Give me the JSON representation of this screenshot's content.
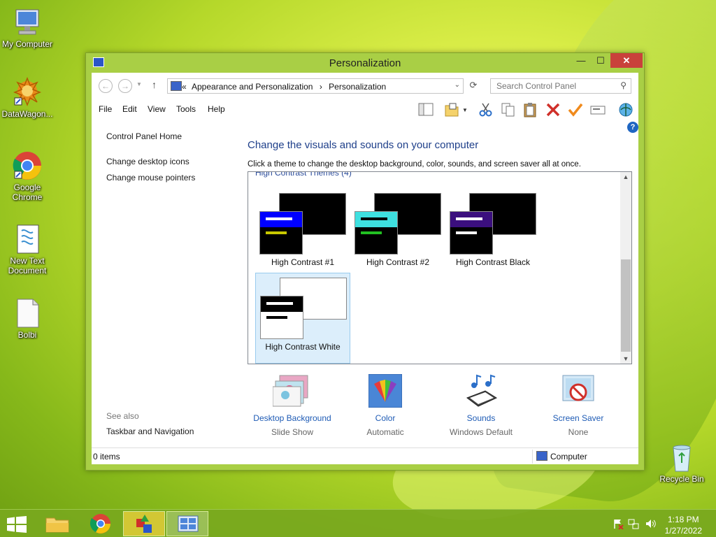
{
  "desktop": {
    "icons": [
      {
        "label": "My Computer",
        "icon": "monitor-icon"
      },
      {
        "label": "DataWagon...",
        "icon": "datawagon-icon"
      },
      {
        "label": "Google Chrome",
        "icon": "chrome-icon"
      },
      {
        "label": "New Text Document",
        "icon": "text-document-icon"
      },
      {
        "label": "Bolbi",
        "icon": "blank-file-icon"
      },
      {
        "label": "Recycle Bin",
        "icon": "recycle-bin-icon"
      }
    ]
  },
  "window": {
    "title": "Personalization",
    "controls": {
      "minimize": "—",
      "maximize": "☐",
      "close": "✕"
    },
    "address": {
      "prefix": "«",
      "crumb1": "Appearance and Personalization",
      "sep": "›",
      "crumb2": "Personalization"
    },
    "search": {
      "placeholder": "Search Control Panel"
    },
    "menu": [
      "File",
      "Edit",
      "View",
      "Tools",
      "Help"
    ],
    "left_pane": {
      "home": "Control Panel Home",
      "links": [
        "Change desktop icons",
        "Change mouse pointers"
      ],
      "see_also_header": "See also",
      "see_also": [
        "Taskbar and Navigation"
      ]
    },
    "main": {
      "heading": "Change the visuals and sounds on your computer",
      "subtext": "Click a theme to change the desktop background, color, sounds, and screen saver all at once.",
      "group_header": "High Contrast Themes (4)",
      "themes": [
        {
          "name": "High Contrast #1",
          "accent": "#0000ff",
          "bar2": "#c8c800"
        },
        {
          "name": "High Contrast #2",
          "accent": "#3ee0e0",
          "bar2": "#22c022"
        },
        {
          "name": "High Contrast Black",
          "accent": "#3b0f7e",
          "bar2": "#ffffff"
        },
        {
          "name": "High Contrast White",
          "accent": "#000000",
          "bar2": "#000000"
        }
      ],
      "selected_theme": "High Contrast White"
    },
    "bottom": [
      {
        "link": "Desktop Background",
        "value": "Slide Show"
      },
      {
        "link": "Color",
        "value": "Automatic"
      },
      {
        "link": "Sounds",
        "value": "Windows Default"
      },
      {
        "link": "Screen Saver",
        "value": "None"
      }
    ],
    "status": {
      "items": "0 items",
      "location": "Computer"
    }
  },
  "taskbar": {
    "time": "1:18 PM",
    "date": "1/27/2022"
  },
  "colors": {
    "title_bar": "#a9cf45",
    "close_button": "#c9413b",
    "link_blue": "#1e5bb5",
    "heading_blue": "#1e3f8a"
  }
}
